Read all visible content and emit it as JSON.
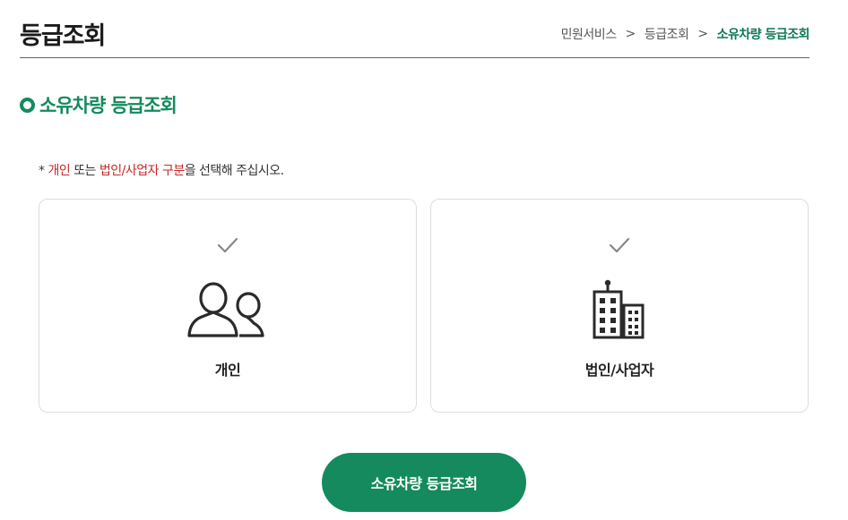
{
  "page": {
    "title": "등급조회"
  },
  "breadcrumb": {
    "items": [
      "민원서비스",
      "등급조회",
      "소유차량 등급조회"
    ],
    "separator": ">"
  },
  "section": {
    "title": "소유차량 등급조회"
  },
  "notice": {
    "prefix": "* ",
    "highlight1": "개인",
    "middle": " 또는 ",
    "highlight2": "법인/사업자 구분",
    "suffix": "을 선택해 주십시오."
  },
  "options": [
    {
      "label": "개인",
      "icon": "people-icon",
      "check_icon": "check-icon"
    },
    {
      "label": "법인/사업자",
      "icon": "building-icon",
      "check_icon": "check-icon"
    }
  ],
  "submit": {
    "label": "소유차량 등급조회"
  },
  "colors": {
    "accent": "#148a5e",
    "highlight": "#c62828",
    "border": "#dddddd"
  }
}
